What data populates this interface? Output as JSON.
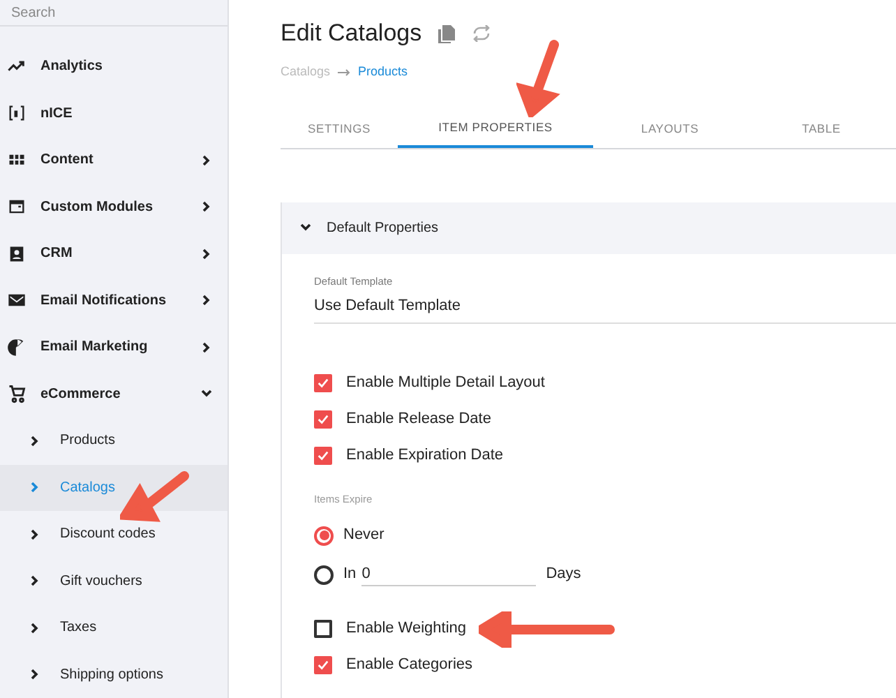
{
  "sidebar": {
    "search": {
      "placeholder": "Search"
    },
    "items": [
      {
        "kind": "analytics",
        "label": "Analytics",
        "has_children": false
      },
      {
        "kind": "nice",
        "label": "nICE",
        "has_children": false
      },
      {
        "kind": "content",
        "label": "Content",
        "has_children": true,
        "expanded": false
      },
      {
        "kind": "modules",
        "label": "Custom Modules",
        "has_children": true,
        "expanded": false
      },
      {
        "kind": "crm",
        "label": "CRM",
        "has_children": true,
        "expanded": false
      },
      {
        "kind": "mail",
        "label": "Email Notifications",
        "has_children": true,
        "expanded": false
      },
      {
        "kind": "marketing",
        "label": "Email Marketing",
        "has_children": true,
        "expanded": false
      },
      {
        "kind": "cart",
        "label": "eCommerce",
        "has_children": true,
        "expanded": true,
        "children": [
          {
            "label": "Products",
            "selected": false
          },
          {
            "label": "Catalogs",
            "selected": true
          },
          {
            "label": "Discount codes",
            "selected": false
          },
          {
            "label": "Gift vouchers",
            "selected": false
          },
          {
            "label": "Taxes",
            "selected": false
          },
          {
            "label": "Shipping options",
            "selected": false
          }
        ]
      }
    ]
  },
  "page": {
    "title": "Edit Catalogs",
    "breadcrumb": [
      "Catalogs",
      "Products"
    ],
    "tabs": [
      {
        "label": "SETTINGS",
        "selected": false
      },
      {
        "label": "ITEM PROPERTIES",
        "selected": true
      },
      {
        "label": "LAYOUTS",
        "selected": false
      },
      {
        "label": "TABLE",
        "selected": false
      }
    ]
  },
  "panel": {
    "title": "Default Properties",
    "expanded": true,
    "template": {
      "label": "Default Template",
      "value": "Use Default Template"
    },
    "checkboxes": [
      {
        "label": "Enable Multiple Detail Layout",
        "checked": true
      },
      {
        "label": "Enable Release Date",
        "checked": true
      },
      {
        "label": "Enable Expiration Date",
        "checked": true
      }
    ],
    "expire": {
      "label": "Items Expire",
      "options": [
        {
          "label": "Never",
          "selected": true
        },
        {
          "label": "In",
          "value": "0",
          "suffix": "Days",
          "selected": false
        }
      ]
    },
    "checkboxes_2": [
      {
        "label": "Enable Weighting",
        "checked": false
      },
      {
        "label": "Enable Categories",
        "checked": true
      }
    ]
  }
}
